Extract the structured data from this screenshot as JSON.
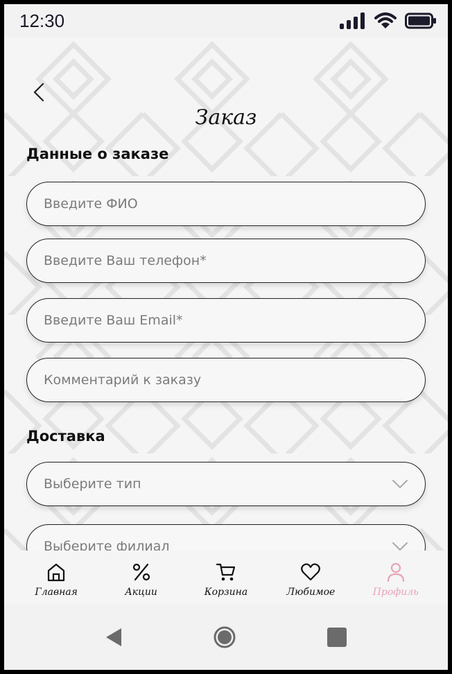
{
  "status": {
    "time": "12:30"
  },
  "header": {
    "title": "Заказ"
  },
  "order_section": {
    "title": "Данные о заказе",
    "fields": [
      {
        "placeholder": "Введите ФИО"
      },
      {
        "placeholder": "Введите Ваш телефон*"
      },
      {
        "placeholder": "Введите Ваш Email*"
      },
      {
        "placeholder": "Комментарий к заказу"
      }
    ]
  },
  "delivery_section": {
    "title": "Доставка",
    "type_select": {
      "placeholder": "Выберите тип"
    },
    "branch_select": {
      "placeholder": "Выберите филиал"
    }
  },
  "nav": {
    "items": [
      {
        "label": "Главная",
        "icon": "home-icon"
      },
      {
        "label": "Акции",
        "icon": "percent-icon"
      },
      {
        "label": "Корзина",
        "icon": "cart-icon"
      },
      {
        "label": "Любимое",
        "icon": "heart-icon"
      },
      {
        "label": "Профиль",
        "icon": "user-icon",
        "active": true
      }
    ],
    "active_color": "#e8a3b6"
  }
}
